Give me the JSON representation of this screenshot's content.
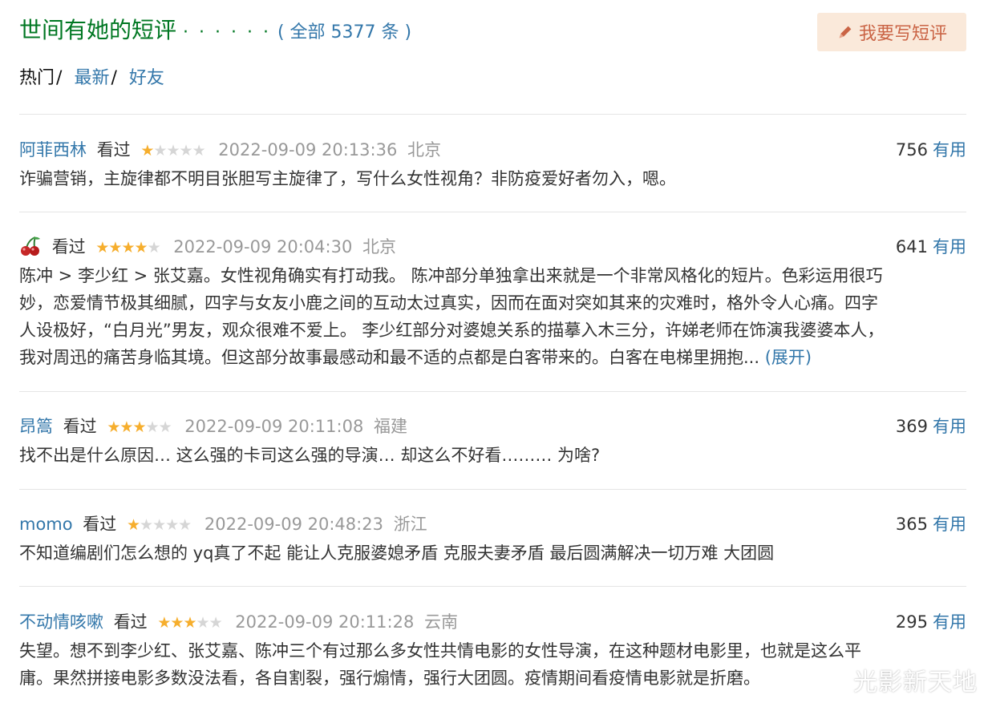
{
  "header": {
    "title": "世间有她的短评",
    "dots": "· · · · · ·",
    "count_text": "( 全部 5377 条 )",
    "write_button": "我要写短评"
  },
  "sort": {
    "hot": "热门",
    "sep1": "/",
    "latest": "最新",
    "sep2": "/",
    "friends": "好友"
  },
  "comments": [
    {
      "author": "阿菲西林",
      "status": "看过",
      "rating": 1,
      "time": "2022-09-09 20:13:36",
      "location": "北京",
      "votes": "756",
      "useful_label": "有用",
      "text": "诈骗营销，主旋律都不明目张胆写主旋律了，写什么女性视角？非防疫爱好者勿入，嗯。"
    },
    {
      "author": "",
      "avatar_icon": "cherry-icon",
      "status": "看过",
      "rating": 4,
      "time": "2022-09-09 20:04:30",
      "location": "北京",
      "votes": "641",
      "useful_label": "有用",
      "text_lines": [
        "陈冲 > 李少红 > 张艾嘉。女性视角确实有打动我。 陈冲部分单独拿出来就是一个非常风格化的短片。色彩运用很巧",
        "妙，恋爱情节极其细腻，四字与女友小鹿之间的互动太过真实，因而在面对突如其来的灾难时，格外令人心痛。四字",
        "人设极好，“白月光”男友，观众很难不爱上。 李少红部分对婆媳关系的描摹入木三分，许娣老师在饰演我婆婆本人，",
        "我对周迅的痛苦身临其境。但这部分故事最感动和最不适的点都是白客带来的。白客在电梯里拥抱..."
      ],
      "expand_label": "(展开)"
    },
    {
      "author": "昂篙",
      "status": "看过",
      "rating": 3,
      "time": "2022-09-09 20:11:08",
      "location": "福建",
      "votes": "369",
      "useful_label": "有用",
      "text": "找不出是什么原因… 这么强的卡司这么强的导演… 却这么不好看……… 为啥?"
    },
    {
      "author": "momo",
      "status": "看过",
      "rating": 1,
      "time": "2022-09-09 20:48:23",
      "location": "浙江",
      "votes": "365",
      "useful_label": "有用",
      "text": "不知道编剧们怎么想的 yq真了不起 能让人克服婆媳矛盾 克服夫妻矛盾 最后圆满解决一切万难 大团圆"
    },
    {
      "author": "不动情咳嗽",
      "status": "看过",
      "rating": 3,
      "time": "2022-09-09 20:11:28",
      "location": "云南",
      "votes": "295",
      "useful_label": "有用",
      "text_lines": [
        "失望。想不到李少红、张艾嘉、陈冲三个有过那么多女性共情电影的女性导演，在这种题材电影里，也就是这么平",
        "庸。果然拼接电影多数没法看，各自割裂，强行煽情，强行大团圆。疫情期间看疫情电影就是折磨。"
      ]
    }
  ],
  "watermark": "光影新天地",
  "colors": {
    "title_green": "#007722",
    "link_blue": "#3377aa",
    "star_on": "#f6ae2d",
    "star_off": "#d6d6d6",
    "meta_gray": "#999999",
    "button_bg": "#fae9da",
    "button_text": "#ca6445"
  }
}
